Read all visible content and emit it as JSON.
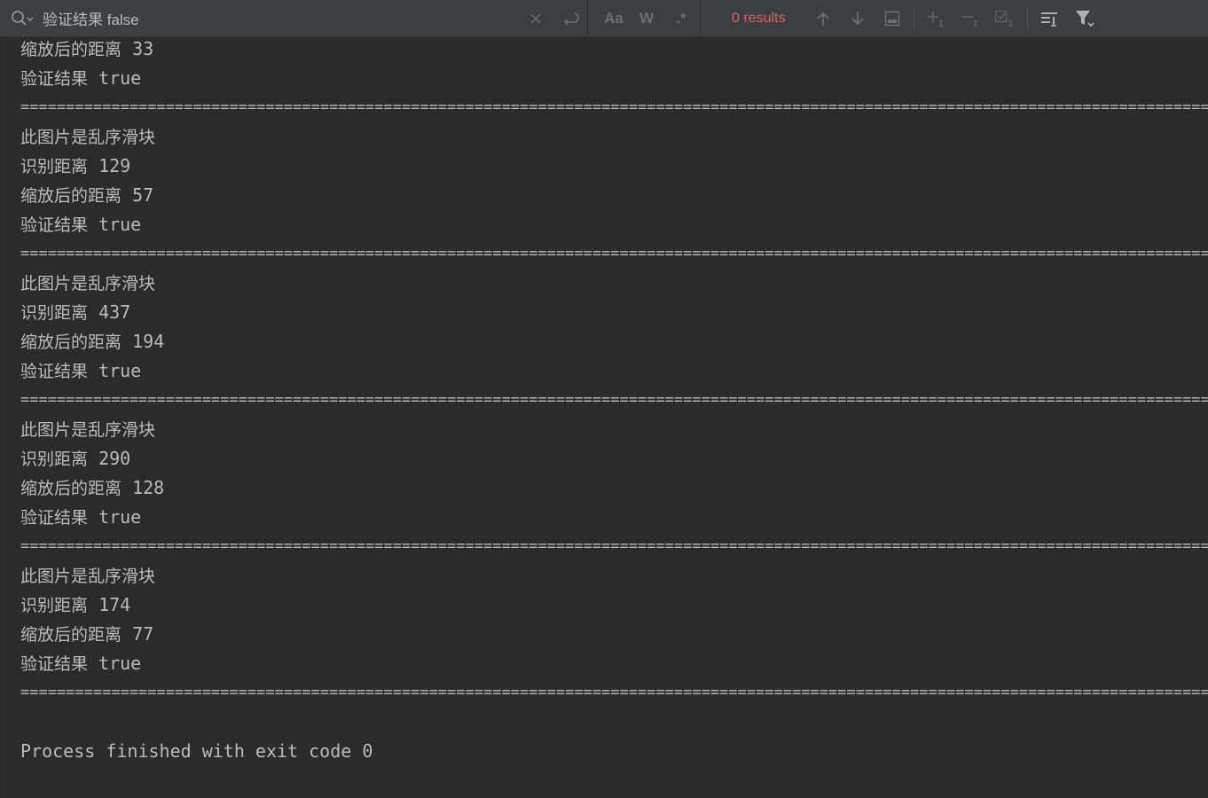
{
  "search": {
    "query": "验证结果 false",
    "results_label": "0 results",
    "match_case_label": "Aa",
    "words_label": "W",
    "regex_label": ".*"
  },
  "console": {
    "lines": [
      {
        "label": "缩放后的距离",
        "value": "33"
      },
      {
        "label": "验证结果",
        "value": "true"
      },
      {
        "separator": "=============================================================================================================================================="
      },
      {
        "label": "此图片是乱序滑块",
        "value": ""
      },
      {
        "label": "识别距离",
        "value": "129"
      },
      {
        "label": "缩放后的距离",
        "value": "57"
      },
      {
        "label": "验证结果",
        "value": "true"
      },
      {
        "separator": "=============================================================================================================================================="
      },
      {
        "label": "此图片是乱序滑块",
        "value": ""
      },
      {
        "label": "识别距离",
        "value": "437"
      },
      {
        "label": "缩放后的距离",
        "value": "194"
      },
      {
        "label": "验证结果",
        "value": "true"
      },
      {
        "separator": "=============================================================================================================================================="
      },
      {
        "label": "此图片是乱序滑块",
        "value": ""
      },
      {
        "label": "识别距离",
        "value": "290"
      },
      {
        "label": "缩放后的距离",
        "value": "128"
      },
      {
        "label": "验证结果",
        "value": "true"
      },
      {
        "separator": "=============================================================================================================================================="
      },
      {
        "label": "此图片是乱序滑块",
        "value": ""
      },
      {
        "label": "识别距离",
        "value": "174"
      },
      {
        "label": "缩放后的距离",
        "value": "77"
      },
      {
        "label": "验证结果",
        "value": "true"
      },
      {
        "separator": "=============================================================================================================================================="
      }
    ],
    "exit_message": "Process finished with exit code 0"
  }
}
